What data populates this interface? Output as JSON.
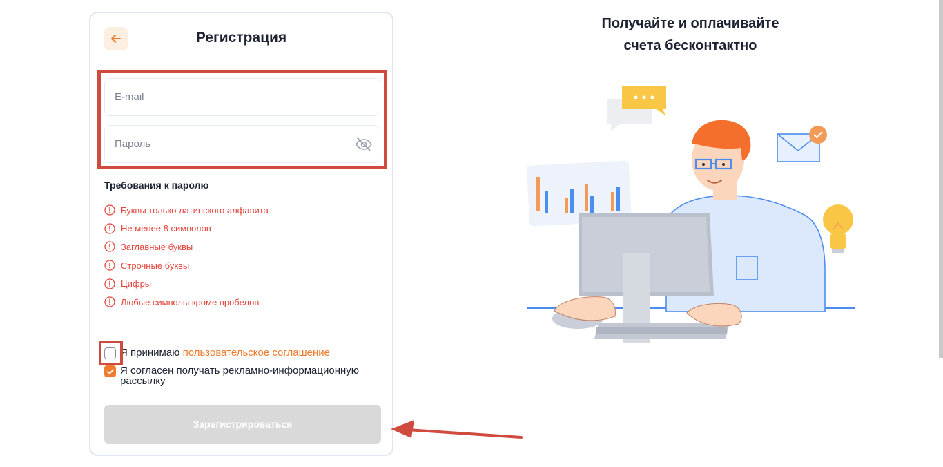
{
  "form": {
    "title": "Регистрация",
    "email_placeholder": "E-mail",
    "password_placeholder": "Пароль",
    "requirements_title": "Требования к паролю",
    "requirements": [
      "Буквы только латинского алфавита",
      "Не менее 8 символов",
      "Заглавные буквы",
      "Строчные буквы",
      "Цифры",
      "Любые символы кроме пробелов"
    ],
    "agreement_prefix": "Я принимаю",
    "agreement_link": "пользовательское соглашение",
    "agreement_checked": false,
    "newsletter_label": "Я согласен получать рекламно-информационную рассылку",
    "newsletter_checked": true,
    "submit_label": "Зарегистрироваться"
  },
  "promo": {
    "title_line1": "Получайте и оплачивайте",
    "title_line2": "счета бесконтактно"
  },
  "colors": {
    "accent": "#f07a2e",
    "error": "#e2433b",
    "annotation": "#cf4b3e",
    "button_disabled": "#d9d9d9"
  },
  "icons": {
    "back": "arrow-left-icon",
    "password_toggle": "eye-off-icon",
    "requirement_status": "exclamation-circle-icon",
    "checkbox_checked": "checkmark-icon"
  }
}
